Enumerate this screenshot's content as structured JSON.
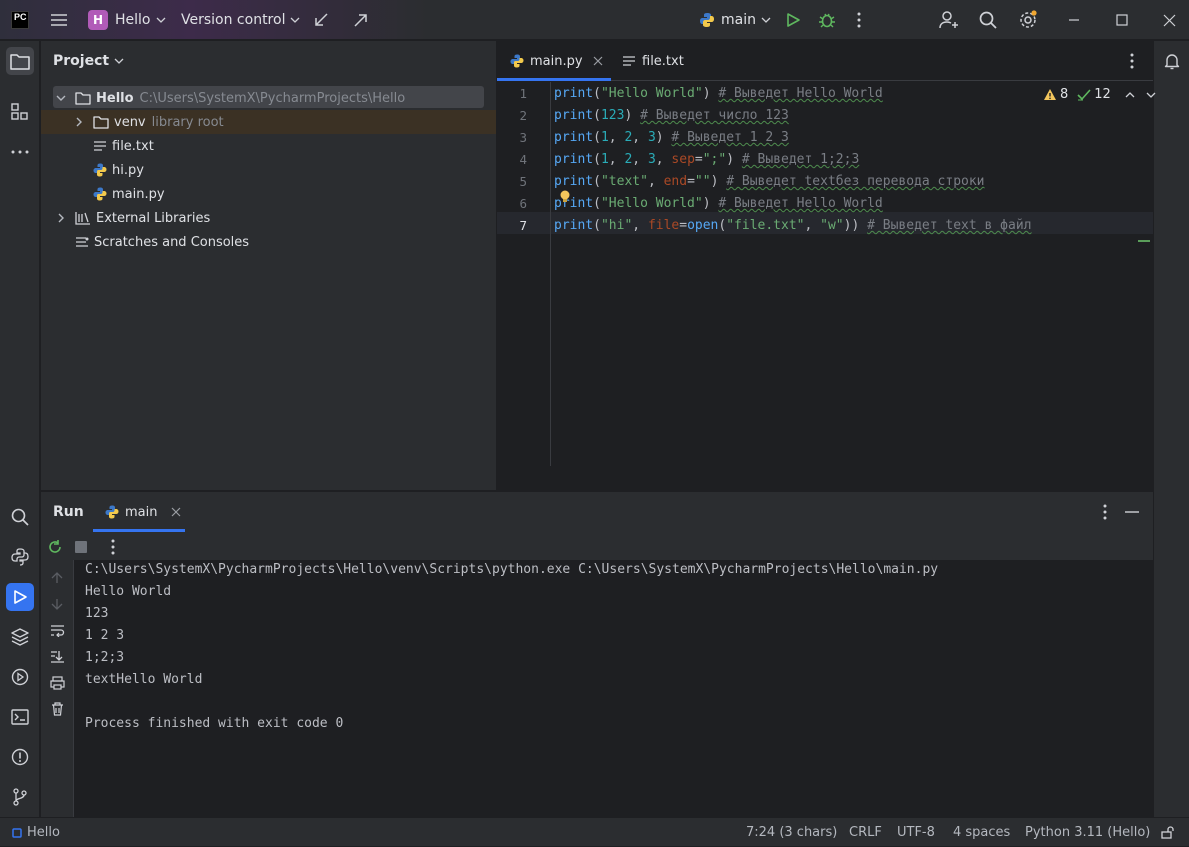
{
  "titlebar": {
    "logo": "PC",
    "project_initial": "H",
    "project_name": "Hello",
    "vcs": "Version control",
    "run_config": "main"
  },
  "project": {
    "title": "Project",
    "tree": [
      {
        "label": "Hello",
        "hint": "C:\\Users\\SystemX\\PycharmProjects\\Hello"
      },
      {
        "label": "venv",
        "hint": "library root"
      },
      {
        "label": "file.txt"
      },
      {
        "label": "hi.py"
      },
      {
        "label": "main.py"
      },
      {
        "label": "External Libraries"
      },
      {
        "label": "Scratches and Consoles"
      }
    ]
  },
  "editor": {
    "tabs": [
      {
        "label": "main.py"
      },
      {
        "label": "file.txt"
      }
    ],
    "inspections": {
      "warnings": "8",
      "ok": "12"
    },
    "lines": [
      [
        {
          "t": "print",
          "c": "fn"
        },
        {
          "t": "(",
          "c": ""
        },
        {
          "t": "\"Hello World\"",
          "c": "st"
        },
        {
          "t": ")",
          "c": ""
        },
        {
          "t": " ",
          "c": ""
        },
        {
          "t": "# Выведет Hello World",
          "c": "cm"
        }
      ],
      [
        {
          "t": "print",
          "c": "fn"
        },
        {
          "t": "(",
          "c": ""
        },
        {
          "t": "123",
          "c": "nm"
        },
        {
          "t": ")",
          "c": ""
        },
        {
          "t": " ",
          "c": ""
        },
        {
          "t": "# Выведет число 123",
          "c": "cm"
        }
      ],
      [
        {
          "t": "print",
          "c": "fn"
        },
        {
          "t": "(",
          "c": ""
        },
        {
          "t": "1",
          "c": "nm"
        },
        {
          "t": ", ",
          "c": ""
        },
        {
          "t": "2",
          "c": "nm"
        },
        {
          "t": ", ",
          "c": ""
        },
        {
          "t": "3",
          "c": "nm"
        },
        {
          "t": ")",
          "c": ""
        },
        {
          "t": " ",
          "c": ""
        },
        {
          "t": "# Выведет 1 2 3",
          "c": "cm"
        }
      ],
      [
        {
          "t": "print",
          "c": "fn"
        },
        {
          "t": "(",
          "c": ""
        },
        {
          "t": "1",
          "c": "nm"
        },
        {
          "t": ", ",
          "c": ""
        },
        {
          "t": "2",
          "c": "nm"
        },
        {
          "t": ", ",
          "c": ""
        },
        {
          "t": "3",
          "c": "nm"
        },
        {
          "t": ", ",
          "c": ""
        },
        {
          "t": "sep",
          "c": "kw"
        },
        {
          "t": "=",
          "c": ""
        },
        {
          "t": "\";\"",
          "c": "st"
        },
        {
          "t": ")",
          "c": ""
        },
        {
          "t": " ",
          "c": ""
        },
        {
          "t": "# Выведет 1;2;3",
          "c": "cm"
        }
      ],
      [
        {
          "t": "print",
          "c": "fn"
        },
        {
          "t": "(",
          "c": ""
        },
        {
          "t": "\"text\"",
          "c": "st"
        },
        {
          "t": ", ",
          "c": ""
        },
        {
          "t": "end",
          "c": "kw"
        },
        {
          "t": "=",
          "c": ""
        },
        {
          "t": "\"\"",
          "c": "st"
        },
        {
          "t": ")",
          "c": ""
        },
        {
          "t": " ",
          "c": ""
        },
        {
          "t": "# Выведет textбез перевода строки",
          "c": "cm"
        }
      ],
      [
        {
          "t": "print",
          "c": "fn"
        },
        {
          "t": "(",
          "c": ""
        },
        {
          "t": "\"Hello World\"",
          "c": "st"
        },
        {
          "t": ")",
          "c": ""
        },
        {
          "t": " ",
          "c": ""
        },
        {
          "t": "# Выведет Hello World",
          "c": "cm"
        }
      ],
      [
        {
          "t": "print",
          "c": "fn"
        },
        {
          "t": "(",
          "c": ""
        },
        {
          "t": "\"hi\"",
          "c": "st"
        },
        {
          "t": ", ",
          "c": ""
        },
        {
          "t": "file",
          "c": "kw"
        },
        {
          "t": "=",
          "c": ""
        },
        {
          "t": "open",
          "c": "fn"
        },
        {
          "t": "(",
          "c": ""
        },
        {
          "t": "\"file.txt\"",
          "c": "st"
        },
        {
          "t": ", ",
          "c": ""
        },
        {
          "t": "\"w\"",
          "c": "st"
        },
        {
          "t": "))",
          "c": ""
        },
        {
          "t": " ",
          "c": ""
        },
        {
          "t": "# Выведет text в файл",
          "c": "cm"
        }
      ]
    ]
  },
  "run": {
    "title": "Run",
    "tab": "main",
    "output": [
      "C:\\Users\\SystemX\\PycharmProjects\\Hello\\venv\\Scripts\\python.exe C:\\Users\\SystemX\\PycharmProjects\\Hello\\main.py",
      "Hello World",
      "123",
      "1 2 3",
      "1;2;3",
      "textHello World",
      "",
      "Process finished with exit code 0"
    ]
  },
  "statusbar": {
    "project": "Hello",
    "position": "7:24 (3 chars)",
    "line_sep": "CRLF",
    "encoding": "UTF-8",
    "indent": "4 spaces",
    "interpreter": "Python 3.11 (Hello)"
  }
}
